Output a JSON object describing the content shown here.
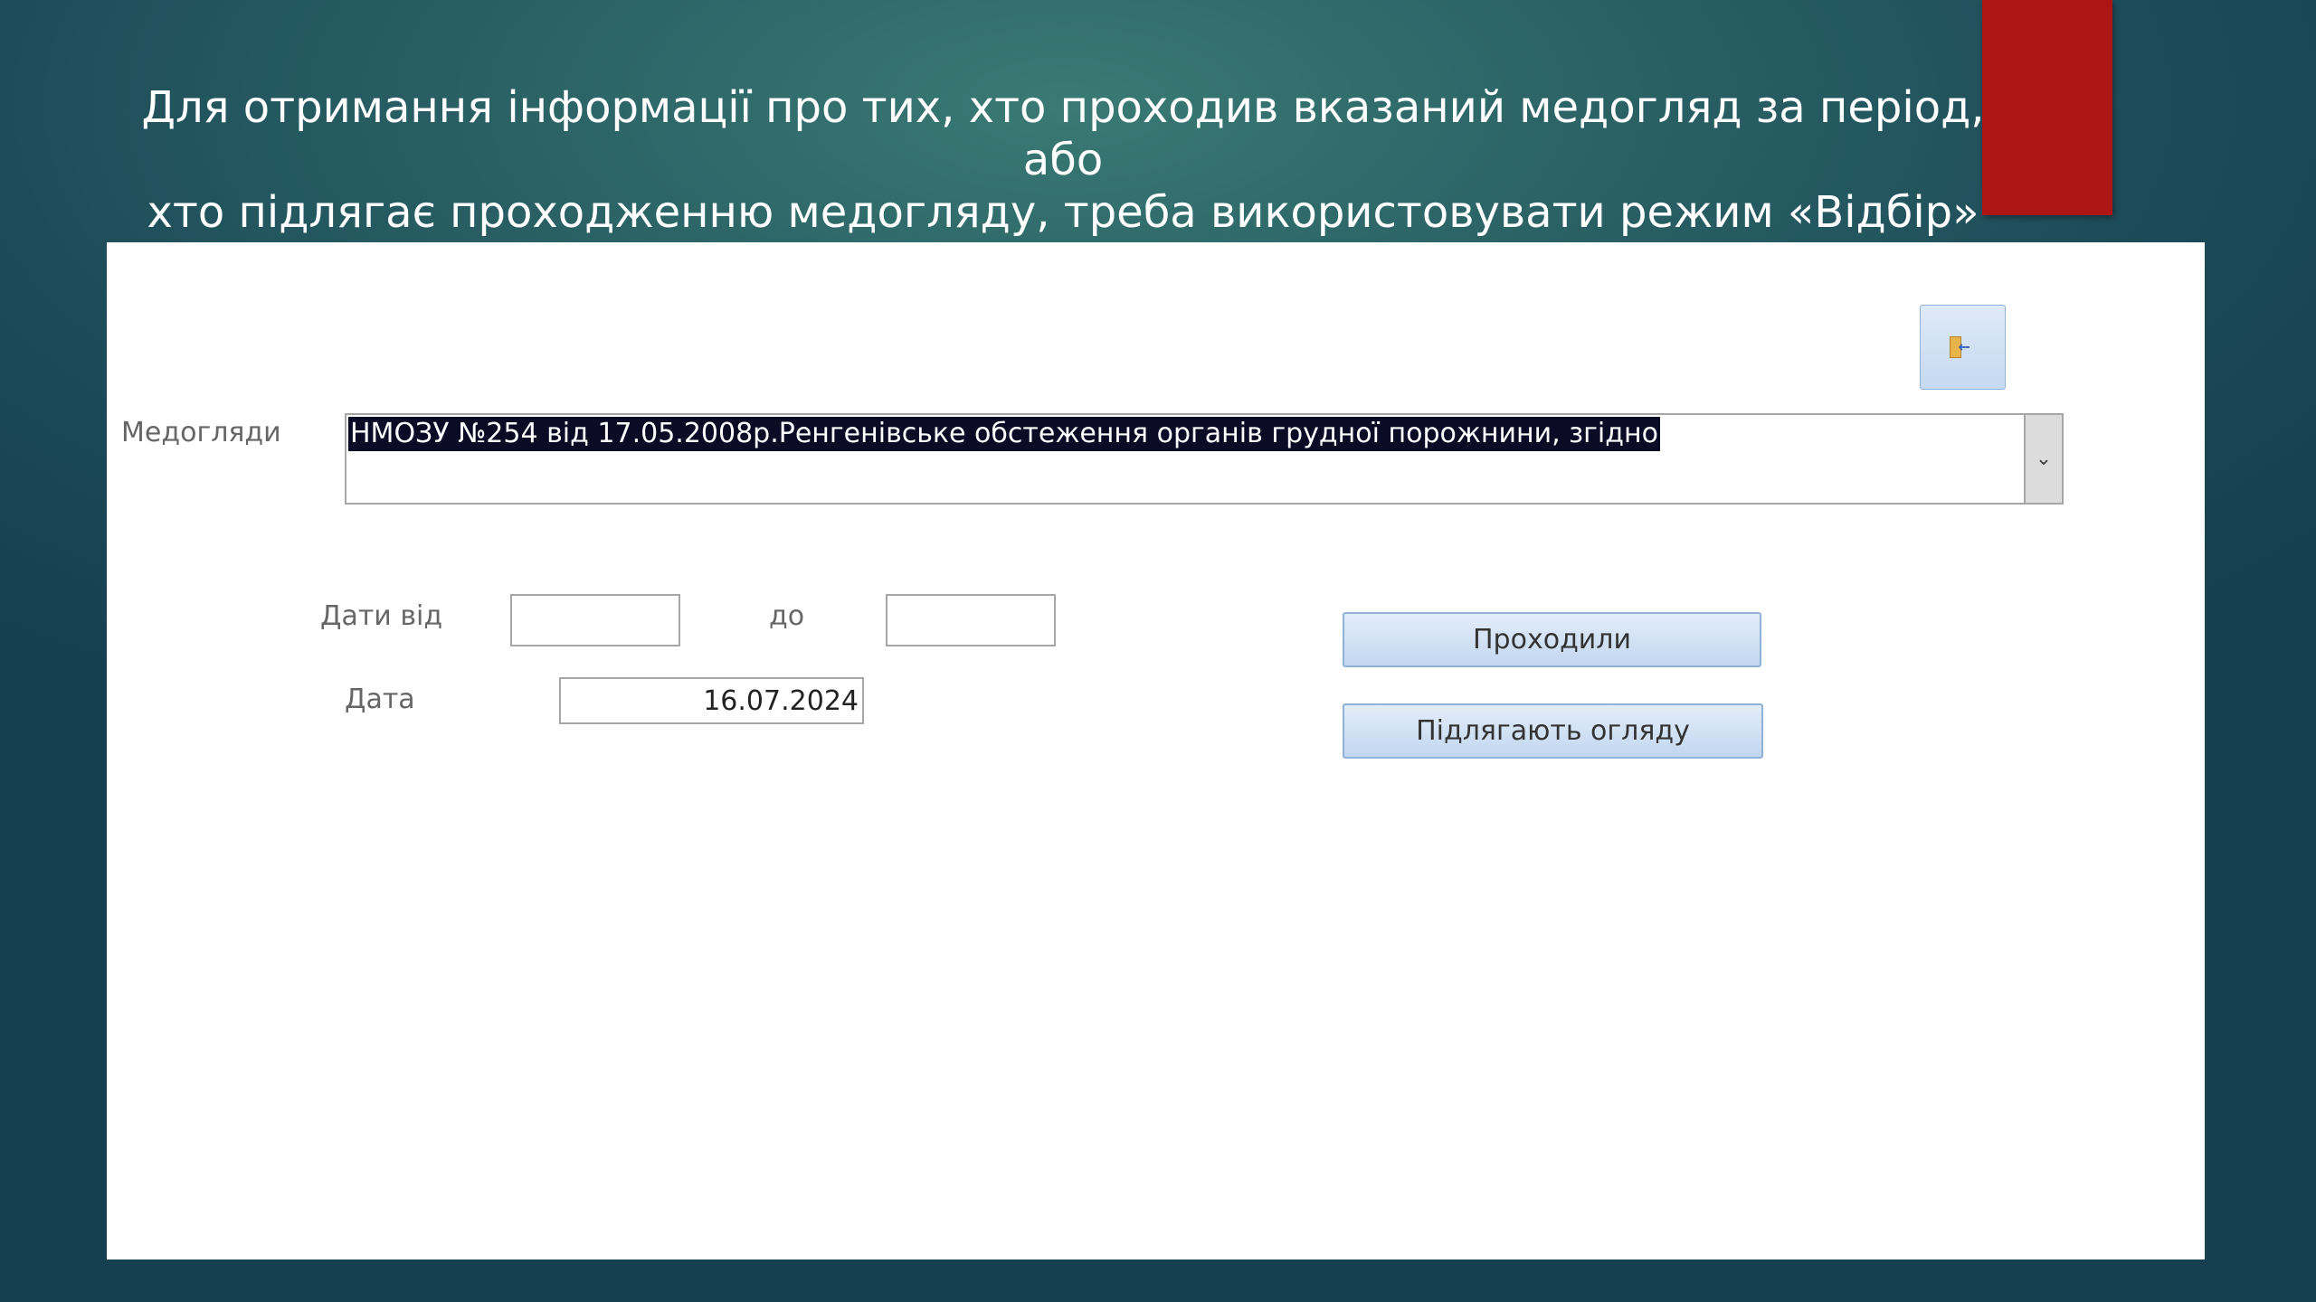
{
  "slide": {
    "title_line1": "Для отримання інформації про тих, хто проходив вказаний медогляд за період, або",
    "title_line2": "хто підлягає проходженню медогляду, треба використовувати режим «Відбір»"
  },
  "form": {
    "exit_icon": "exit-door-icon",
    "medogliady_label": "Медогляди",
    "medogliady_value": "НМОЗУ №254 від 17.05.2008р.Ренгенівське обстеження органів грудної порожнини, згідно",
    "dropdown_icon": "chevron-down-icon",
    "dates_from_label": "Дати від",
    "dates_from_value": "",
    "dates_to_label": "до",
    "dates_to_value": "",
    "date_label": "Дата",
    "date_value": "16.07.2024",
    "passed_button": "Проходили",
    "subject_button": "Підлягають огляду"
  },
  "colors": {
    "background": "#1c4a58",
    "accent_tab": "#ad1515",
    "selection": "#0b0b26",
    "button": "#c5d9f1"
  }
}
